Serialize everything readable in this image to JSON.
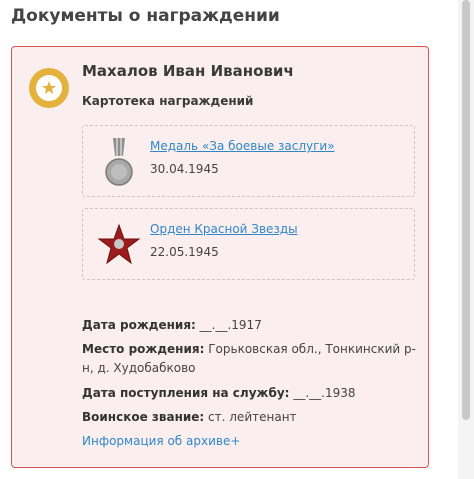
{
  "page": {
    "title": "Документы о награждении"
  },
  "card": {
    "name": "Махалов Иван Иванович",
    "subtitle": "Картотека награждений",
    "awards": [
      {
        "title": "Медаль «За боевые заслуги»",
        "date": "30.04.1945",
        "icon": "medal-icon"
      },
      {
        "title": "Орден Красной Звезды",
        "date": "22.05.1945",
        "icon": "red-star-order-icon"
      }
    ],
    "info": {
      "birth_date_label": "Дата рождения:",
      "birth_date_value": "__.__.1917",
      "birth_place_label": "Место рождения:",
      "birth_place_value": "Горьковская обл., Тонкинский р-н, д. Худобабково",
      "service_start_label": "Дата поступления на службу:",
      "service_start_value": "__.__.1938",
      "rank_label": "Воинское звание:",
      "rank_value": "ст. лейтенант"
    },
    "archive_link": "Информация об архиве+"
  },
  "colors": {
    "card_border": "#d9534f",
    "card_background": "#fbeeee",
    "link": "#2f87c7",
    "badge": "#e3b23c"
  }
}
